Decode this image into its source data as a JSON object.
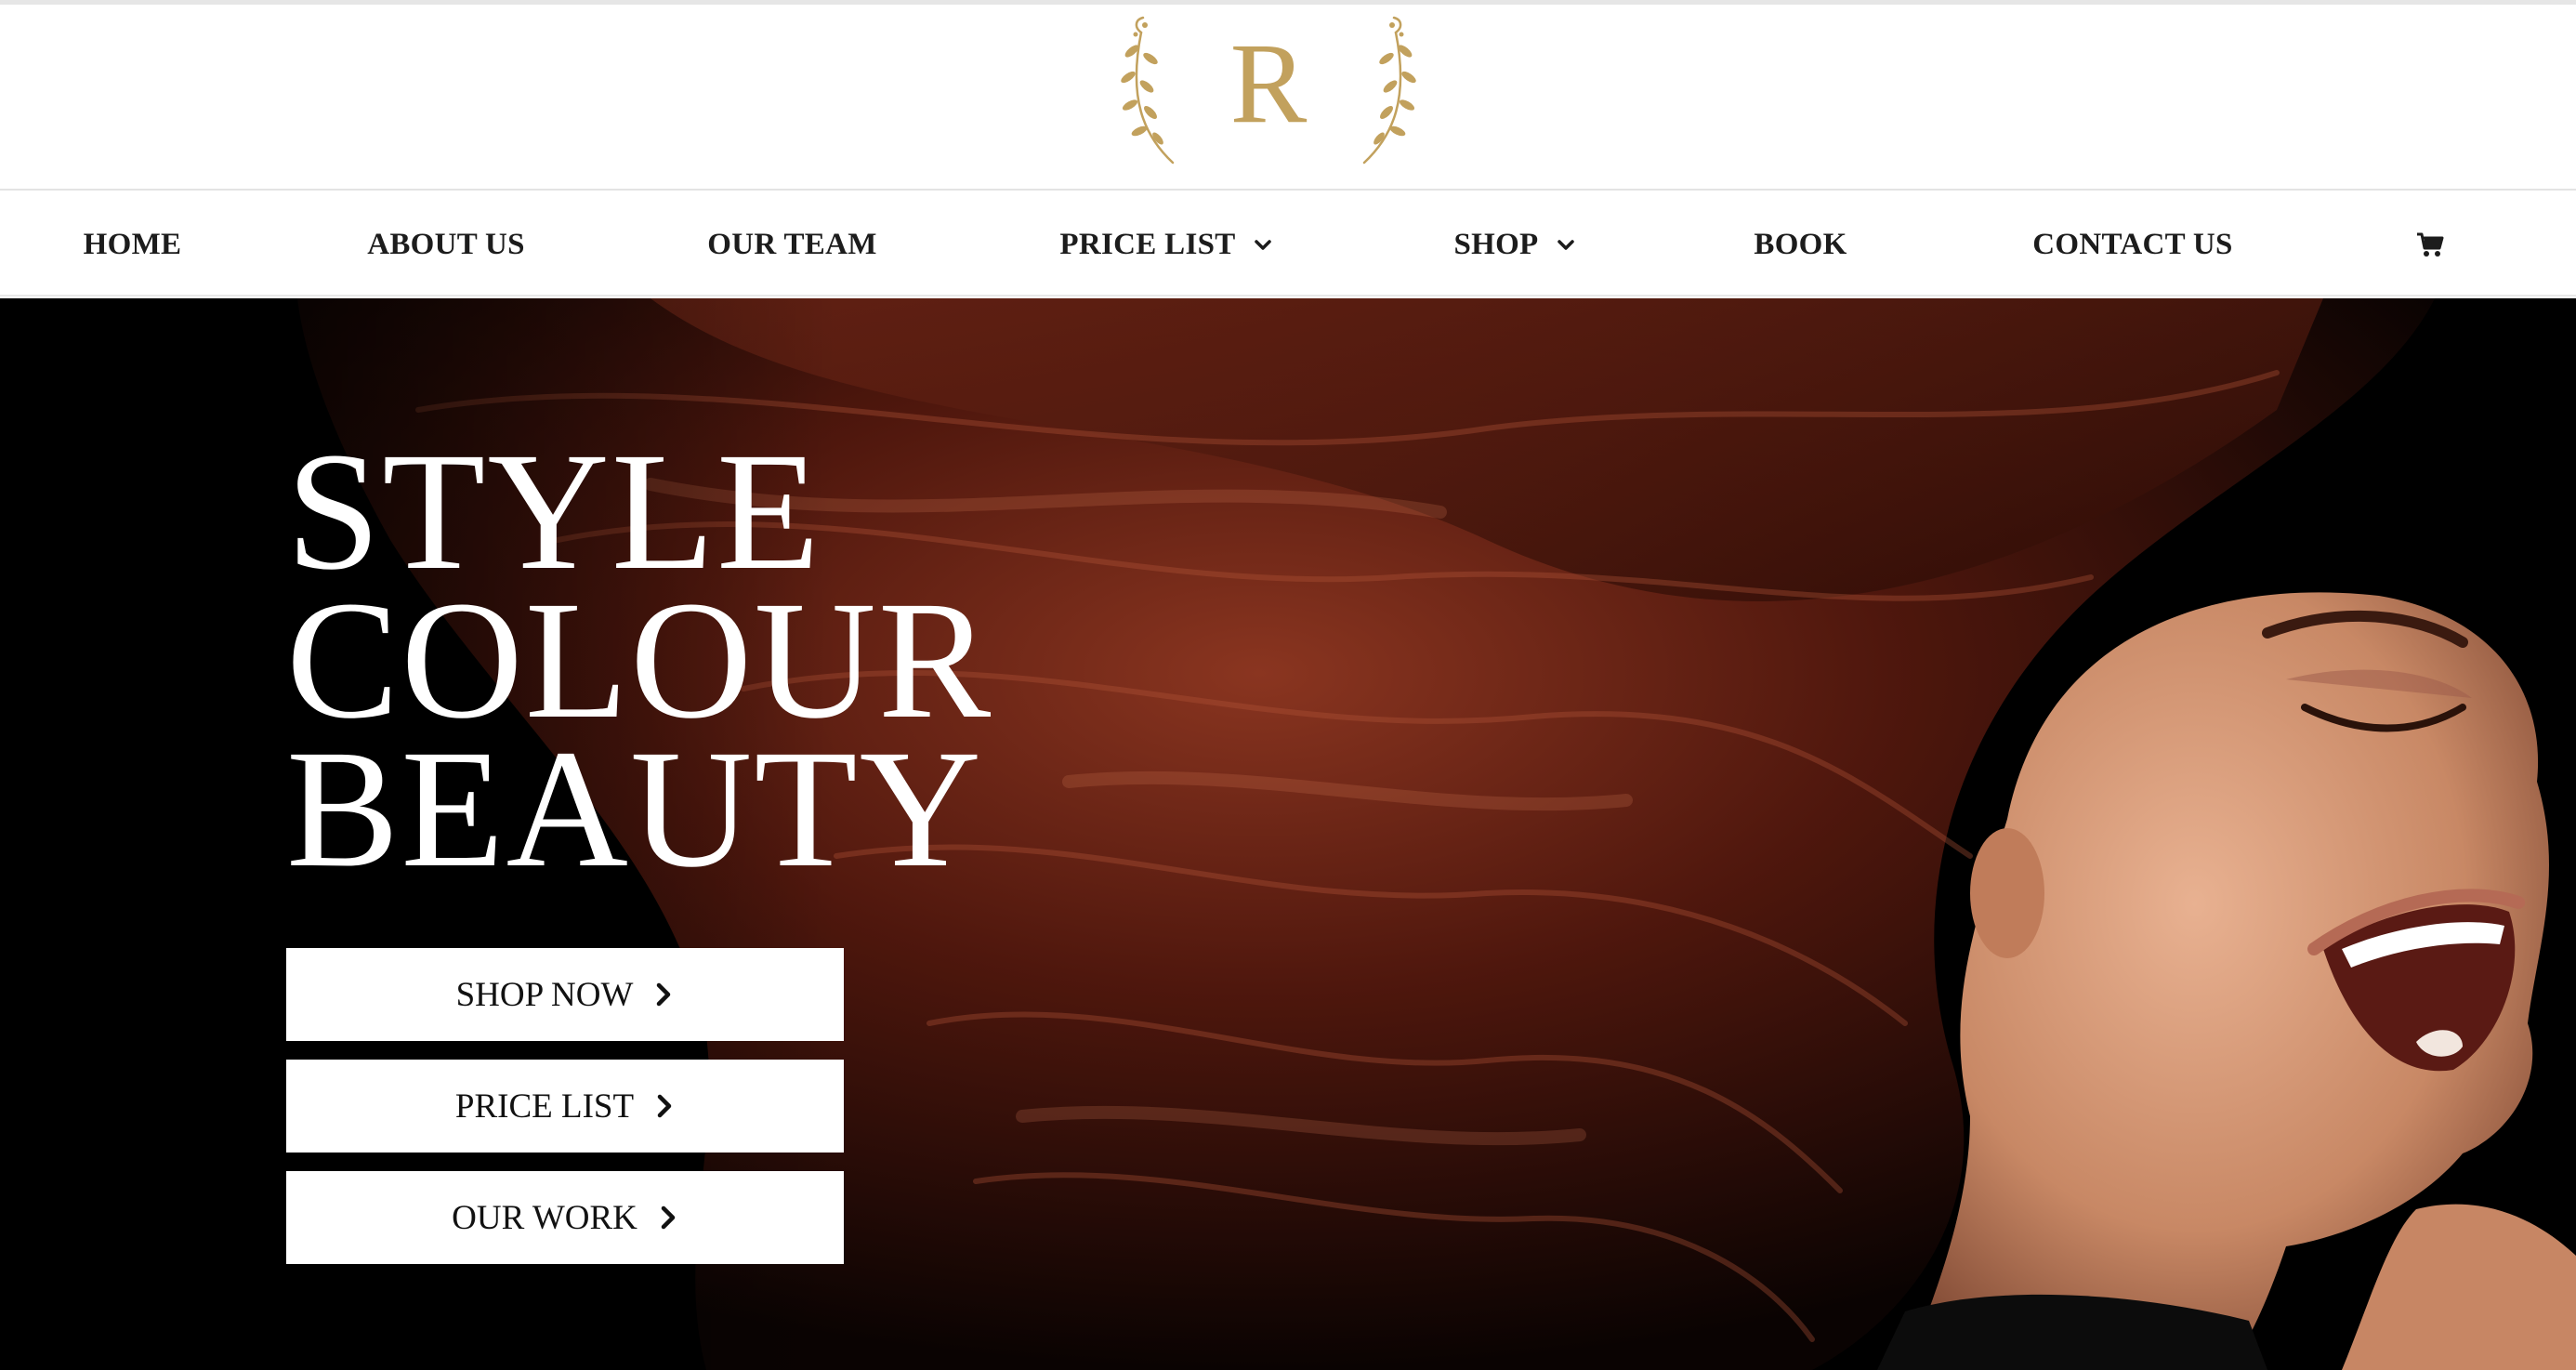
{
  "logo": {
    "letter": "R"
  },
  "nav": {
    "items": [
      {
        "label": "HOME"
      },
      {
        "label": "ABOUT US"
      },
      {
        "label": "OUR TEAM"
      },
      {
        "label": "PRICE LIST"
      },
      {
        "label": "SHOP"
      },
      {
        "label": "BOOK"
      },
      {
        "label": "CONTACT US"
      }
    ],
    "cart_icon": "shopping-cart-icon"
  },
  "hero": {
    "title_lines": [
      "STYLE",
      "COLOUR",
      "BEAUTY"
    ],
    "buttons": [
      {
        "label": "SHOP NOW"
      },
      {
        "label": "PRICE LIST"
      },
      {
        "label": "OUR WORK"
      }
    ]
  },
  "colors": {
    "gold": "#c2a15d",
    "nav_text": "#1c1c1c",
    "hero_bg": "#000000",
    "hair": "#5a1e12"
  }
}
